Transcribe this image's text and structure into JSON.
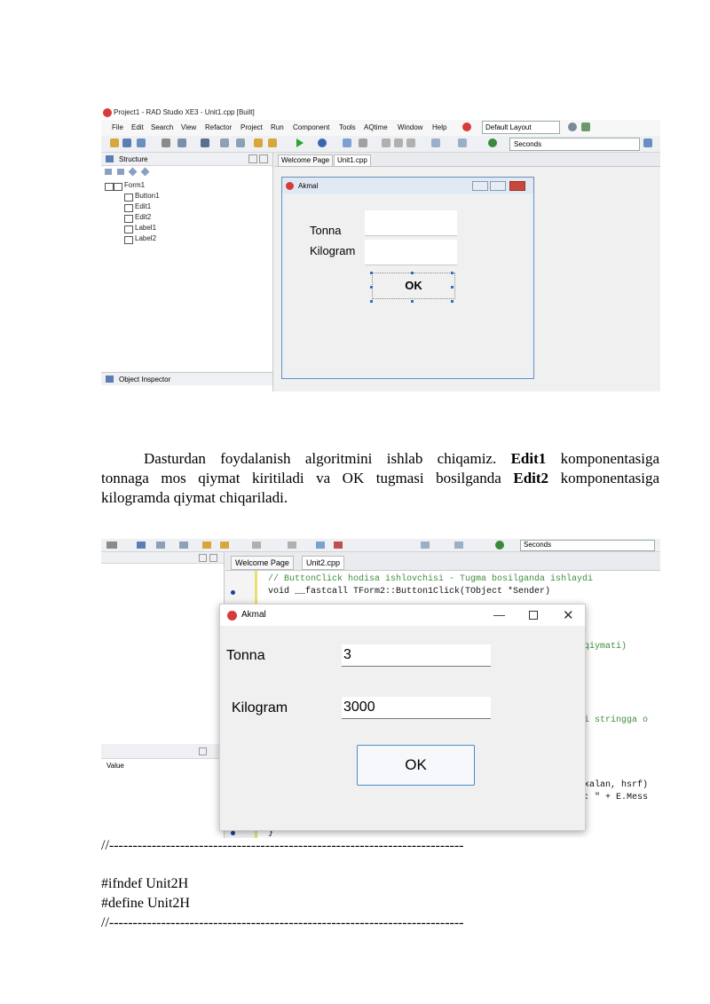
{
  "ide": {
    "title": "Project1 - RAD Studio XE3 - Unit1.cpp [Built]",
    "menu": [
      "File",
      "Edit",
      "Search",
      "View",
      "Refactor",
      "Project",
      "Run",
      "Component",
      "Tools",
      "AQtime",
      "Window",
      "Help"
    ],
    "layout_value": "Default Layout",
    "seconds_value": "Seconds",
    "structure_panel": {
      "title": "Structure",
      "tree": [
        "Form1",
        "Button1",
        "Edit1",
        "Edit2",
        "Label1",
        "Label2"
      ]
    },
    "object_inspector_title": "Object Inspector",
    "tabs": [
      "Welcome Page",
      "Unit1.cpp"
    ],
    "form": {
      "title": "Akmal",
      "label_tonna": "Tonna",
      "label_kilogram": "Kilogram",
      "ok_button": "OK"
    }
  },
  "paragraph": {
    "l1_a": "Dasturdan foydalanish algoritmini ishlab chiqamiz.",
    "l1_b": "Edit1",
    "l1_c": "komponentasiga",
    "l2_a": "tonnaga mos qiymat kiritiladi va OK tugmasi bosilganda",
    "l2_b": "Edit2",
    "l2_c": "komponentasiga",
    "l3": "kilogramda qiymat chiqariladi."
  },
  "run": {
    "seconds_value": "Seconds",
    "tabs": [
      "Welcome Page",
      "Unit2.cpp"
    ],
    "code_lines": {
      "comment": "// ButtonClick hodisa ishlovchisi - Tugma bosilganda ishlaydi",
      "signature": "void __fastcall TForm2::Button1Click(TObject *Sender)",
      "frag_qiymati": "qiymati)",
      "frag_stringga": "i stringga o",
      "frag_xatolik": "xalan, hsrf)",
      "frag_emess": ": \" + E.Mess",
      "brace": "}"
    },
    "value_label": "Value",
    "dialog": {
      "title": "Akmal",
      "label_tonna": "Tonna",
      "value_tonna": "3",
      "label_kilogram": "Kilogram",
      "value_kilogram": "3000",
      "ok_button": "OK"
    }
  },
  "code_after": {
    "sep1": "//---------------------------------------------------------------------------",
    "ifndef": "#ifndef Unit2H",
    "define": "#define Unit2H",
    "sep2": "//---------------------------------------------------------------------------"
  }
}
